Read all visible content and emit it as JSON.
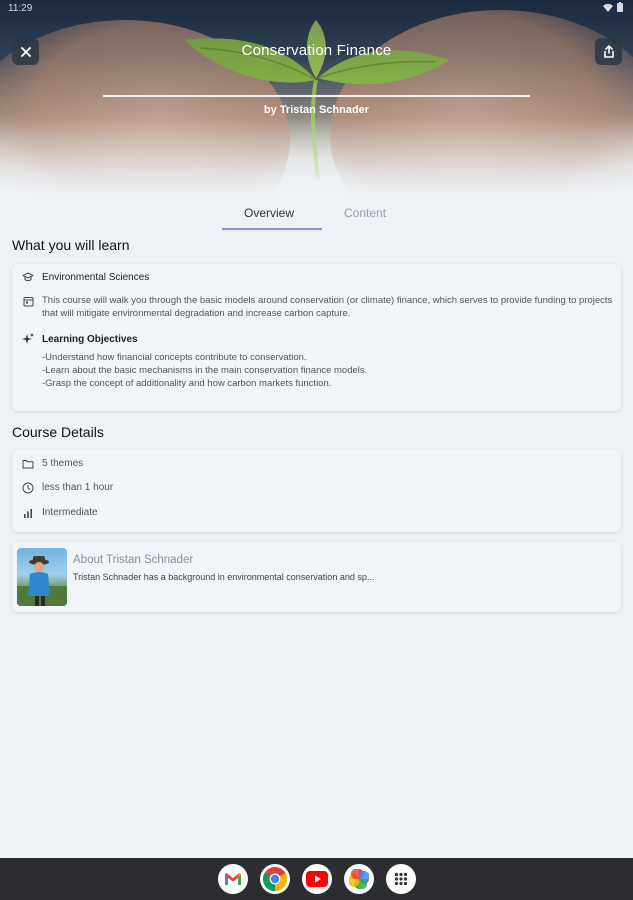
{
  "status_bar": {
    "time": "11:29"
  },
  "header": {
    "title": "Conservation Finance",
    "author": "by Tristan Schnader",
    "close_icon": "close-icon",
    "share_icon": "share-icon"
  },
  "tabs": [
    {
      "label": "Overview",
      "active": true
    },
    {
      "label": "Content",
      "active": false
    }
  ],
  "learn": {
    "title": "What you will learn",
    "subject": "Environmental Sciences",
    "description": "This course will walk you through the basic models around conservation (or climate) finance, which serves to provide funding to projects that will mitigate environmental degradation and increase carbon capture.",
    "objectives_title": "Learning Objectives",
    "objectives": [
      "-Understand how financial concepts contribute to conservation.",
      "-Learn about the basic mechanisms in the main conservation finance models.",
      "-Grasp the concept of additionality and how carbon markets function."
    ]
  },
  "details": {
    "title": "Course Details",
    "themes": "5 themes",
    "duration": "less than 1 hour",
    "level": "Intermediate"
  },
  "about": {
    "title": "About Tristan Schnader",
    "bio": "Tristan Schnader has a background in environmental conservation and sp..."
  },
  "dock": {
    "apps": [
      "gmail-icon",
      "chrome-icon",
      "youtube-icon",
      "photos-icon",
      "app-drawer-icon"
    ]
  },
  "colors": {
    "accent": "#8b8fd8",
    "background": "#eef2f6",
    "dock": "#2b2d30"
  }
}
